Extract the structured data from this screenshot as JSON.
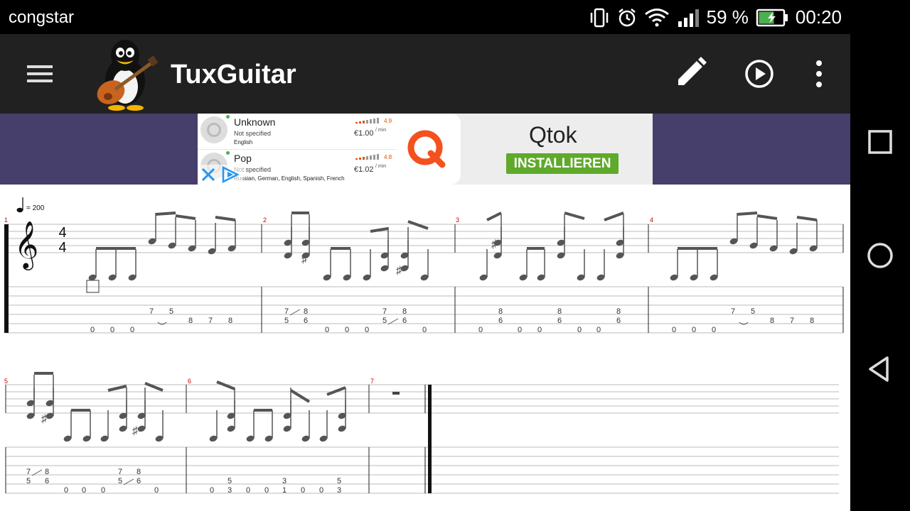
{
  "status_bar": {
    "carrier": "congstar",
    "battery": "59 %",
    "time": "00:20",
    "icons": [
      "vibrate-icon",
      "alarm-icon",
      "wifi-icon",
      "signal-icon",
      "battery-charging-icon"
    ]
  },
  "app_bar": {
    "title": "TuxGuitar",
    "icons": [
      "menu-icon",
      "tux-guitar-logo",
      "edit-pencil-icon",
      "play-icon",
      "overflow-menu-icon"
    ],
    "colors": {
      "background": "#212121",
      "text": "#ffffff"
    }
  },
  "ad": {
    "rows": [
      {
        "name": "Unknown",
        "detail": "Not specified",
        "languages": "English",
        "price": "€1.00",
        "per": "/ min",
        "rating": "4.9"
      },
      {
        "name": "Pop",
        "detail": "Not specified",
        "languages": "Russian, German, English, Spanish, French",
        "price": "€1.02",
        "per": "/ min",
        "rating": "4.8"
      }
    ],
    "brand": "Qtok",
    "install_label": "INSTALLIEREN",
    "colors": {
      "band": "#463e6b",
      "install": "#5fa92b",
      "logo": "#f4511e"
    }
  },
  "score": {
    "tempo": "= 200",
    "time_signature": {
      "numerator": "4",
      "denominator": "4"
    },
    "measure_numbers": [
      "1",
      "2",
      "3",
      "4",
      "5",
      "6",
      "7"
    ],
    "tab_numbers": [
      "7",
      "5",
      "0",
      "0",
      "0",
      "8",
      "7",
      "8",
      "6",
      "1",
      "3"
    ],
    "colors": {
      "measure_number": "#cc0000",
      "note": "#555555",
      "staff_line": "#bbbbbb"
    }
  },
  "nav_bar": {
    "icons": [
      "recent-apps-icon",
      "home-icon",
      "back-icon"
    ]
  }
}
